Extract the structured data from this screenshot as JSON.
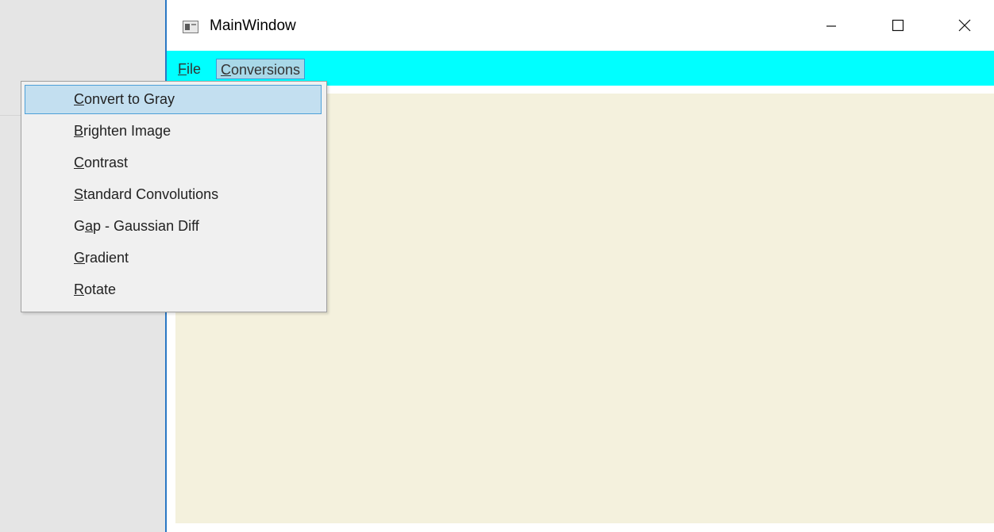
{
  "window": {
    "title": "MainWindow",
    "border_color": "#2b78c4"
  },
  "caption_buttons": {
    "minimize_icon": "minimize-icon",
    "maximize_icon": "maximize-icon",
    "close_icon": "close-icon"
  },
  "menubar": {
    "background": "#00ffff",
    "items": [
      {
        "label": "File",
        "accelerator_index": 0
      },
      {
        "label": "Conversions",
        "accelerator_index": 0,
        "active": true
      }
    ]
  },
  "conversions_menu": {
    "items": [
      {
        "label": "Convert to Gray",
        "accelerator_index": 0,
        "selected": true
      },
      {
        "label": "Brighten Image",
        "accelerator_index": 0
      },
      {
        "label": "Contrast",
        "accelerator_index": 0
      },
      {
        "label": "Standard Convolutions",
        "accelerator_index": 0
      },
      {
        "label": "Gap - Gaussian Diff",
        "accelerator_index": 1
      },
      {
        "label": "Gradient",
        "accelerator_index": 0
      },
      {
        "label": "Rotate",
        "accelerator_index": 0
      }
    ]
  },
  "content": {
    "background": "#f4f1dd"
  }
}
